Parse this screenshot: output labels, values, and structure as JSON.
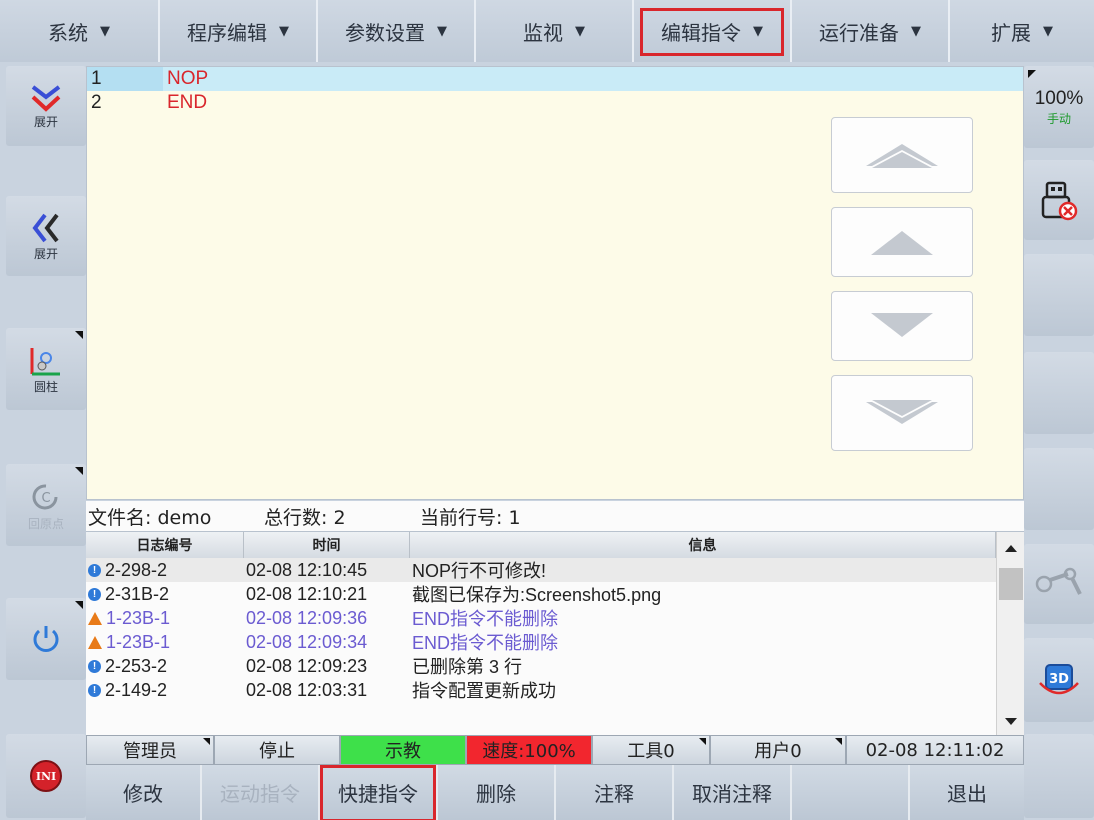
{
  "menu": [
    {
      "label": "系统"
    },
    {
      "label": "程序编辑"
    },
    {
      "label": "参数设置"
    },
    {
      "label": "监视"
    },
    {
      "label": "编辑指令"
    },
    {
      "label": "运行准备"
    },
    {
      "label": "扩展"
    }
  ],
  "left": {
    "expand_down_label": "展开",
    "expand_left_label": "展开",
    "coord_label": "圆柱",
    "reset_label": "回原点"
  },
  "right": {
    "speed": "100%",
    "mode": "手动"
  },
  "program": {
    "lines": [
      {
        "num": "1",
        "cmd": "NOP"
      },
      {
        "num": "2",
        "cmd": "END"
      }
    ]
  },
  "fileinfo": {
    "filename": "文件名: demo",
    "total": "总行数: 2",
    "current": "当前行号: 1"
  },
  "log": {
    "headers": [
      "日志编号",
      "时间",
      "信息"
    ],
    "rows": [
      {
        "id": "2-298-2",
        "time": "02-08 12:10:45",
        "msg": "NOP行不可修改!",
        "level": "info"
      },
      {
        "id": "2-31B-2",
        "time": "02-08 12:10:21",
        "msg": "截图已保存为:Screenshot5.png",
        "level": "info"
      },
      {
        "id": "1-23B-1",
        "time": "02-08 12:09:36",
        "msg": "END指令不能删除",
        "level": "warn"
      },
      {
        "id": "1-23B-1",
        "time": "02-08 12:09:34",
        "msg": "END指令不能删除",
        "level": "warn"
      },
      {
        "id": "2-253-2",
        "time": "02-08 12:09:23",
        "msg": "已删除第 3 行",
        "level": "info"
      },
      {
        "id": "2-149-2",
        "time": "02-08 12:03:31",
        "msg": "指令配置更新成功",
        "level": "info"
      }
    ]
  },
  "status": {
    "user": "管理员",
    "state": "停止",
    "mode": "示教",
    "speed": "速度:100%",
    "tool": "工具0",
    "user_frame": "用户0",
    "datetime": "02-08 12:11:02"
  },
  "functions": {
    "modify": "修改",
    "motion": "运动指令",
    "quick": "快捷指令",
    "delete": "删除",
    "comment": "注释",
    "uncomment": "取消注释",
    "blank": "",
    "exit": "退出"
  },
  "colors": {
    "highlight": "#d9262c",
    "teach_green": "#3ee04a",
    "speed_red": "#f2262e"
  }
}
